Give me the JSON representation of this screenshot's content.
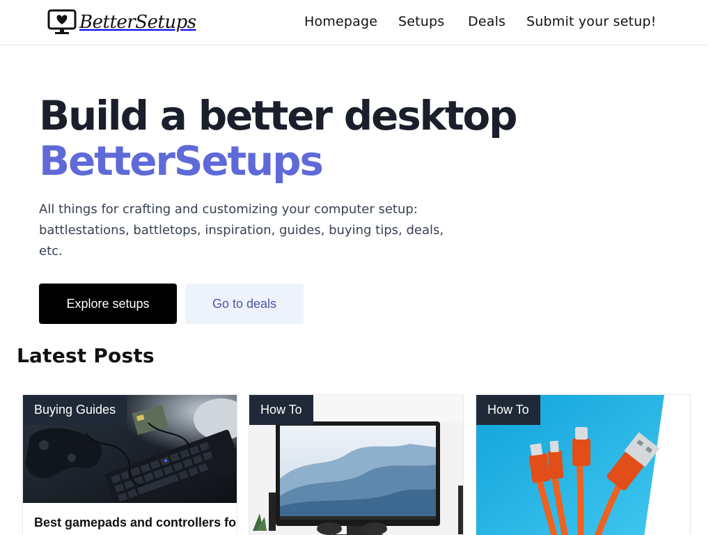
{
  "header": {
    "brand_name": "BetterSetups",
    "nav": {
      "home": "Homepage",
      "setups": "Setups",
      "deals": "Deals",
      "submit": "Submit your setup!"
    }
  },
  "hero": {
    "title": "Build a better desktop",
    "brand": "BetterSetups",
    "description": "All things for crafting and customizing your computer setup: battlestations, battletops, inspiration, guides, buying tips, deals, etc.",
    "primary_button": "Explore setups",
    "secondary_button": "Go to deals"
  },
  "latest": {
    "heading": "Latest Posts",
    "posts": [
      {
        "category": "Buying Guides",
        "title": "Best gamepads and controllers for"
      },
      {
        "category": "How To",
        "title": ""
      },
      {
        "category": "How To",
        "title": ""
      }
    ]
  },
  "colors": {
    "accent": "#5f6ad8",
    "text_dark": "#1a1f2b",
    "secondary_bg": "#eef2fb",
    "tag_bg": "#1f2937"
  },
  "icons": {
    "logo": "heart-monitor-icon"
  }
}
